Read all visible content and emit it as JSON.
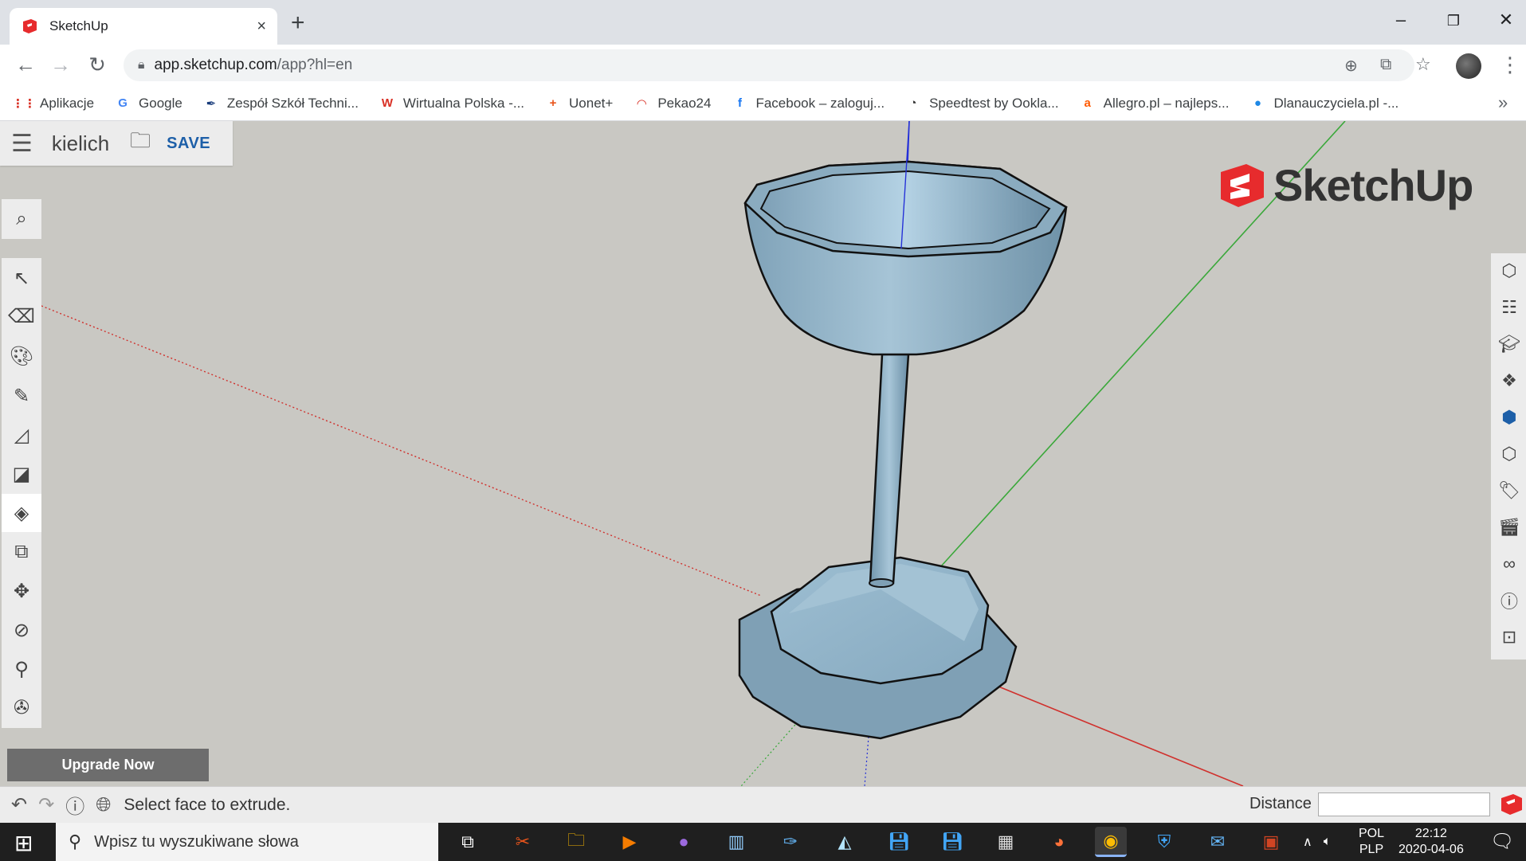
{
  "browser": {
    "tab_title": "SketchUp",
    "tab_close": "×",
    "new_tab": "+",
    "minimize": "–",
    "restore": "❐",
    "close": "✕",
    "url_host": "app.sketchup.com",
    "url_path": "/app?hl=en",
    "bookmarks": [
      {
        "label": "Aplikacje",
        "icon": "apps-grid-icon",
        "glyph": "⋮⋮",
        "color": "#d93025"
      },
      {
        "label": "Google",
        "icon": "google-icon",
        "glyph": "G",
        "color": "#4285f4"
      },
      {
        "label": "Zespół Szkół Techni...",
        "icon": "school-icon",
        "glyph": "✒",
        "color": "#1a3d7c"
      },
      {
        "label": "Wirtualna Polska -...",
        "icon": "wp-icon",
        "glyph": "W",
        "color": "#d93025"
      },
      {
        "label": "Uonet+",
        "icon": "uonet-icon",
        "glyph": "+",
        "color": "#e8541b"
      },
      {
        "label": "Pekao24",
        "icon": "pekao-icon",
        "glyph": "◠",
        "color": "#d93025"
      },
      {
        "label": "Facebook – zaloguj...",
        "icon": "facebook-icon",
        "glyph": "f",
        "color": "#1877f2"
      },
      {
        "label": "Speedtest by Ookla...",
        "icon": "speedtest-icon",
        "glyph": "◔",
        "color": "#333333"
      },
      {
        "label": "Allegro.pl – najleps...",
        "icon": "allegro-icon",
        "glyph": "a",
        "color": "#ff5a00"
      },
      {
        "label": "Dlanauczyciela.pl -...",
        "icon": "globe-dot-icon",
        "glyph": "●",
        "color": "#1e88e5"
      }
    ],
    "bookmarks_more": "»"
  },
  "sketchup": {
    "doc_title": "kielich",
    "save_label": "SAVE",
    "logo_text": "SketchUp",
    "upgrade_label": "Upgrade Now",
    "status_message": "Select face to extrude.",
    "distance_label": "Distance",
    "distance_value": "",
    "colors": {
      "model_fill": "#8fb0c4",
      "axis_red": "#d0312d",
      "axis_green": "#3aa83a",
      "axis_blue": "#2430d8",
      "brand_red": "#e72b2d"
    }
  },
  "taskbar": {
    "search_placeholder": "Wpisz tu wyszukiwane słowa",
    "lang_top": "POL",
    "lang_bottom": "PLP",
    "time": "22:12",
    "date": "2020-04-06"
  }
}
